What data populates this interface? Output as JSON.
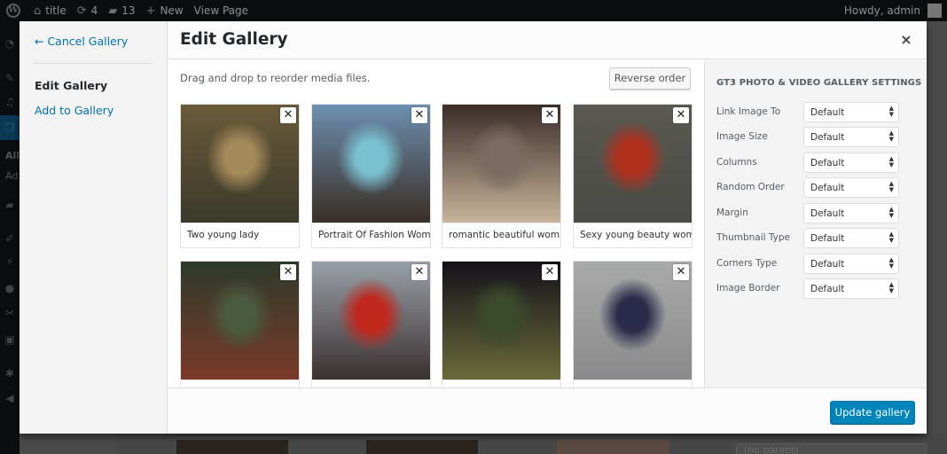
{
  "adminbar": {
    "site_title": "title",
    "updates_count": "4",
    "comments_count": "13",
    "new_label": "New",
    "view_label": "View Page",
    "greeting": "Howdy, admin",
    "icons": [
      "wordpress-logo",
      "home-icon",
      "updates-icon",
      "comments-icon",
      "plus-icon"
    ]
  },
  "adminmenu": {
    "visible_text": [
      "All",
      "Ad"
    ]
  },
  "background": {
    "parent_select": "(no parent)"
  },
  "modal": {
    "menu": {
      "cancel": "← Cancel Gallery",
      "edit": "Edit Gallery",
      "add": "Add to Gallery"
    },
    "title": "Edit Gallery",
    "close_glyph": "×",
    "toolbar": {
      "instructions": "Drag and drop to reorder media files.",
      "reverse_label": "Reverse order"
    },
    "attachments": [
      {
        "caption": "Two young lady",
        "colors": [
          "#6a5a3a",
          "#a58a5a",
          "#3a3a2a"
        ]
      },
      {
        "caption": "Portrait Of Fashion Woma",
        "colors": [
          "#6d8fb0",
          "#7ac1d0",
          "#3a2e26"
        ]
      },
      {
        "caption": "romantic beautiful woma",
        "colors": [
          "#3a2c28",
          "#7a6a60",
          "#c8b49a"
        ]
      },
      {
        "caption": "Sexy young beauty woma",
        "colors": [
          "#5a5a52",
          "#b0301e",
          "#4a4a46"
        ]
      },
      {
        "caption": "",
        "colors": [
          "#2e3a2a",
          "#4a5a3c",
          "#7a3a2a"
        ]
      },
      {
        "caption": "",
        "colors": [
          "#9aa0a8",
          "#c0281e",
          "#3a3030"
        ]
      },
      {
        "caption": "",
        "colors": [
          "#14121a",
          "#3a4a2a",
          "#6a6a3a"
        ]
      },
      {
        "caption": "",
        "colors": [
          "#a8aaa8",
          "#2a2a4a",
          "#8a8a8c"
        ]
      }
    ],
    "remove_glyph": "✕",
    "settings": {
      "heading": "GT3 PHOTO & VIDEO GALLERY SETTINGS",
      "arrows_glyph": "▲▼",
      "fields": [
        {
          "label": "Link Image To",
          "value": "Default"
        },
        {
          "label": "Image Size",
          "value": "Default"
        },
        {
          "label": "Columns",
          "value": "Default"
        },
        {
          "label": "Random Order",
          "value": "Default"
        },
        {
          "label": "Margin",
          "value": "Default"
        },
        {
          "label": "Thumbnail Type",
          "value": "Default"
        },
        {
          "label": "Corners Type",
          "value": "Default"
        },
        {
          "label": "Image Border",
          "value": "Default"
        }
      ]
    },
    "update_label": "Update gallery"
  }
}
